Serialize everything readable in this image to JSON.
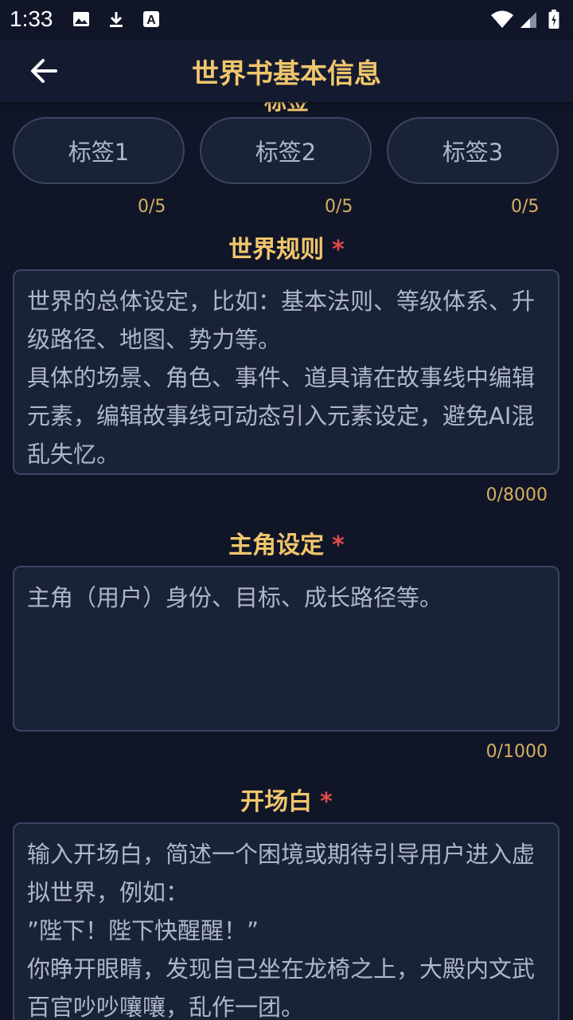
{
  "status_bar": {
    "time": "1:33",
    "icons": [
      "image-icon",
      "download-icon",
      "a-icon",
      "wifi-icon",
      "signal-icon",
      "battery-icon"
    ]
  },
  "app_bar": {
    "title": "世界书基本信息",
    "back_icon": "arrow-left-icon"
  },
  "partial_heading": "标签",
  "tags": [
    {
      "placeholder": "标签1",
      "count": "0/5"
    },
    {
      "placeholder": "标签2",
      "count": "0/5"
    },
    {
      "placeholder": "标签3",
      "count": "0/5"
    }
  ],
  "world_rules": {
    "label": "世界规则",
    "required_mark": "*",
    "placeholder": "世界的总体设定，比如：基本法则、等级体系、升级路径、地图、势力等。\n具体的场景、角色、事件、道具请在故事线中编辑元素，编辑故事线可动态引入元素设定，避免AI混乱失忆。",
    "counter": "0/8000"
  },
  "protagonist": {
    "label": "主角设定",
    "required_mark": "*",
    "placeholder": "主角（用户）身份、目标、成长路径等。",
    "counter": "0/1000"
  },
  "opening": {
    "label": "开场白",
    "required_mark": "*",
    "placeholder": "输入开场白，简述一个困境或期待引导用户进入虚拟世界，例如：\n”陛下！陛下快醒醒！”\n你睁开眼睛，发现自己坐在龙椅之上，大殿内文武百官吵吵嚷嚷，乱作一团。"
  },
  "colors": {
    "background": "#111528",
    "accent": "#f0c66c",
    "required": "#e24a4a",
    "counter": "#d6b060",
    "field_bg": "#1a2238",
    "field_border": "#3a4560"
  }
}
